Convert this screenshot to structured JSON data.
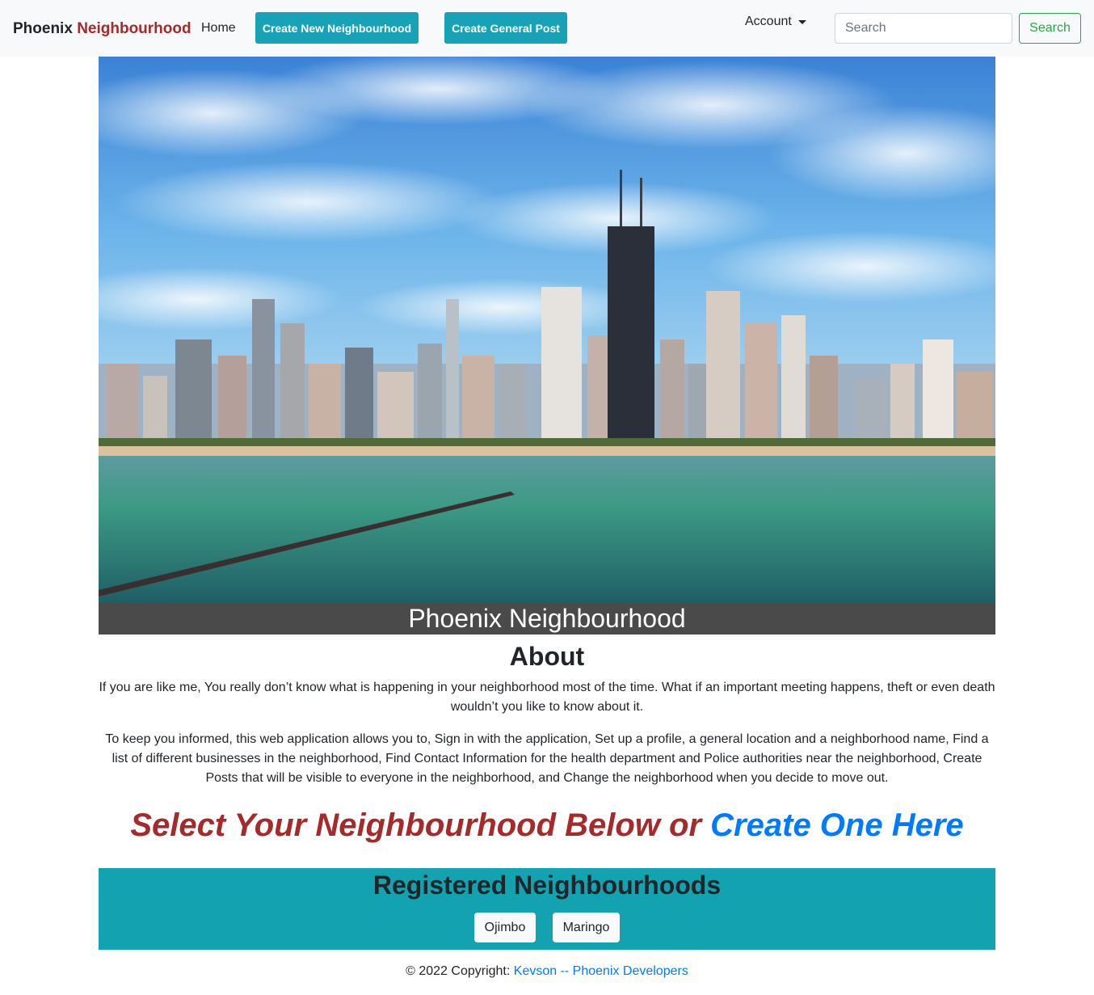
{
  "navbar": {
    "brand_part1": "Phoenix",
    "brand_part2": "Neighbourhood",
    "home_label": "Home",
    "create_neighbourhood_label": "Create New Neighbourhood",
    "create_post_label": "Create General Post",
    "account_label": "Account",
    "search_placeholder": "Search",
    "search_button_label": "Search"
  },
  "hero": {
    "caption": "Phoenix Neighbourhood"
  },
  "about": {
    "title": "About",
    "paragraph1": "If you are like me, You really don’t know what is happening in your neighborhood most of the time. What if an important meeting happens, theft or even death wouldn’t you like to know about it.",
    "paragraph2": "To keep you informed, this web application allows you to, Sign in with the application, Set up a profile, a general location and a neighborhood name, Find a list of different businesses in the neighborhood, Find Contact Information for the health department and Police authorities near the neighborhood, Create Posts that will be visible to everyone in the neighborhood, and Change the neighborhood when you decide to move out."
  },
  "cta": {
    "text": "Select Your Neighbourhood Below or ",
    "link_text": "Create One Here"
  },
  "registered": {
    "title": "Registered Neighbourhoods",
    "items": [
      {
        "label": "Ojimbo"
      },
      {
        "label": "Maringo"
      }
    ]
  },
  "footer": {
    "copyright": "© 2022 Copyright: ",
    "link_text": "Kevson -- Phoenix Developers"
  },
  "colors": {
    "brand_accent": "#a52a2a",
    "teal": "#17a2b8",
    "registered_bg": "#13a2b0",
    "link": "#007bff",
    "success": "#28a745",
    "caption_bg": "#4a4a4a"
  }
}
